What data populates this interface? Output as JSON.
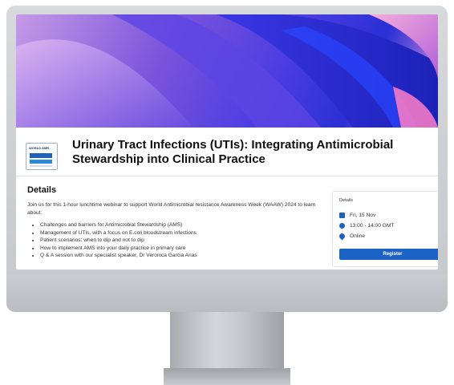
{
  "event": {
    "title": "Urinary Tract Infections (UTIs): Integrating Antimicrobial Stewardship into Clinical Practice",
    "logo_text": "WORLD AMR",
    "details_heading": "Details",
    "intro": "Join us for this 1-hour lunchtime webinar to support World Antimicrobial resistance Awareness Week (WAAW) 2024 to learn about:",
    "topics": [
      "Challenges and barriers for Antimicrobial Stewardship (AMS)",
      "Management of UTIs, with a focus on E.coli bloodstream infections",
      "Patient scenarios: when to dip and not to dip",
      "How to implement AMS into your daily practice in primary care",
      "Q & A session with our specialist speaker, Dr Veronica Garcia Arias"
    ]
  },
  "card": {
    "title": "Details",
    "date": "Fri, 15 Nov",
    "time": "13:00 - 14:00 GMT",
    "location": "Online",
    "register_label": "Register"
  },
  "icons": [
    "calendar-icon",
    "clock-icon",
    "location-pin-icon"
  ],
  "colors": {
    "accent": "#1d63c6",
    "banner_purple": "#4d3ee2"
  }
}
